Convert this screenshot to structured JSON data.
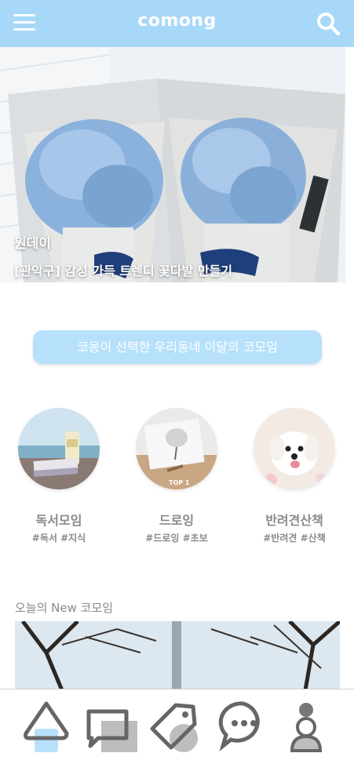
{
  "header": {
    "brand": "comong",
    "menu_icon": "hamburger-menu-icon",
    "search_icon": "search-icon",
    "color": "#a7d8f8"
  },
  "hero": {
    "category": "원데이",
    "title": "[관악구] 감성 가득 트렌디 꽃다발 만들기",
    "slide_count": 3,
    "active_slide": 1
  },
  "pick_button": {
    "label": "코몽이 선택한 우리동네 이달의 코모임",
    "color": "#b7e1fb"
  },
  "categories": [
    {
      "name": "독서모임",
      "tags": "#독서 #지식",
      "image": "book-by-sea-photo"
    },
    {
      "name": "드로잉",
      "tags": "#드로잉 #초보",
      "image": "drawing-easel-photo",
      "badge": "TOP 1"
    },
    {
      "name": "반려견산책",
      "tags": "#반려견 #산책",
      "image": "white-dog-photo"
    }
  ],
  "new_section": {
    "title": "오늘의 New 코모임",
    "image": "tree-and-tower-photo"
  },
  "tabbar": {
    "items": [
      {
        "icon": "home-icon",
        "active": true
      },
      {
        "icon": "chat-icon"
      },
      {
        "icon": "tag-icon"
      },
      {
        "icon": "message-bubble-icon"
      },
      {
        "icon": "profile-icon"
      }
    ]
  }
}
